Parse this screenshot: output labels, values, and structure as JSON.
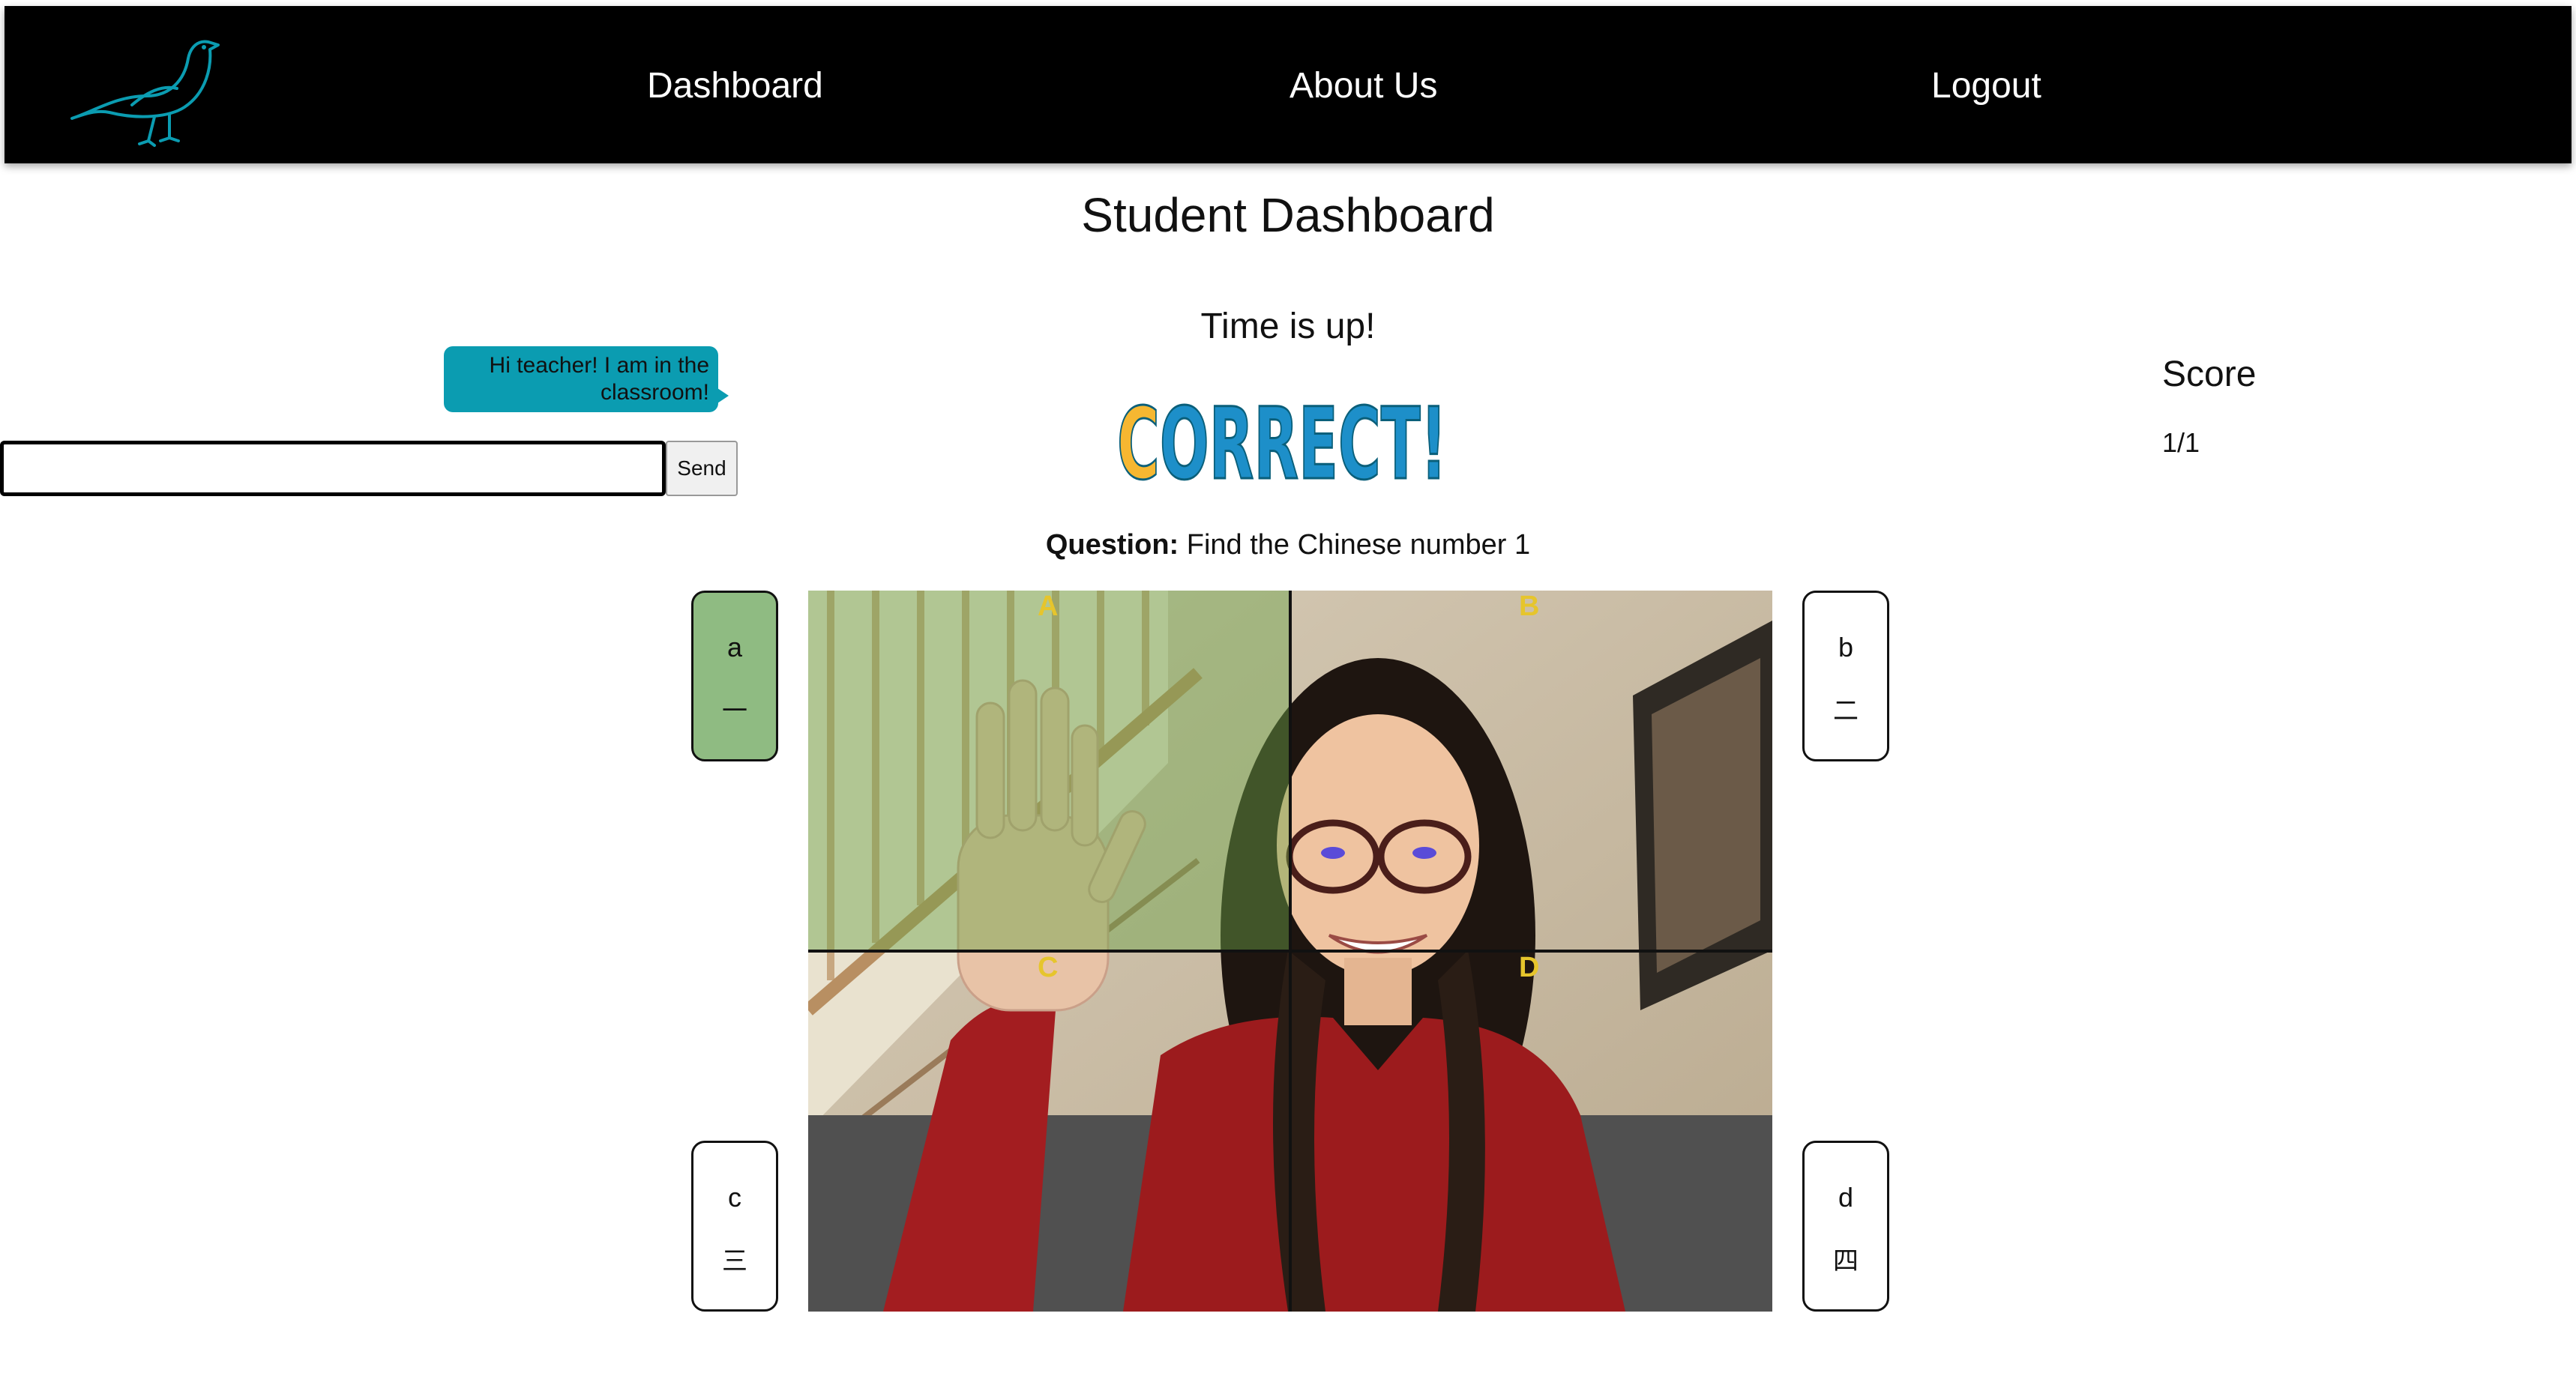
{
  "nav": {
    "logo_icon": "bird-logo-icon",
    "logo_color": "#0b9cb1",
    "links": [
      "Dashboard",
      "About Us",
      "Logout"
    ]
  },
  "page": {
    "title": "Student Dashboard"
  },
  "chat": {
    "message": "Hi teacher! I am in the classroom!",
    "input_value": "",
    "send_label": "Send",
    "bubble_color": "#0b9cb1"
  },
  "game": {
    "timer_text": "Time is up!",
    "result_text": "CORRECT!",
    "question_label": "Question:",
    "question_text": "Find the Chinese number 1",
    "quadrant_labels": [
      "A",
      "B",
      "C",
      "D"
    ],
    "quadrant_label_color": "#e6c52c",
    "selected_color": "#8fbb82",
    "answers": [
      {
        "letter": "a",
        "char": "一",
        "selected": true
      },
      {
        "letter": "b",
        "char": "二",
        "selected": false
      },
      {
        "letter": "c",
        "char": "三",
        "selected": false
      },
      {
        "letter": "d",
        "char": "四",
        "selected": false
      }
    ]
  },
  "score": {
    "label": "Score",
    "value": "1/1"
  }
}
